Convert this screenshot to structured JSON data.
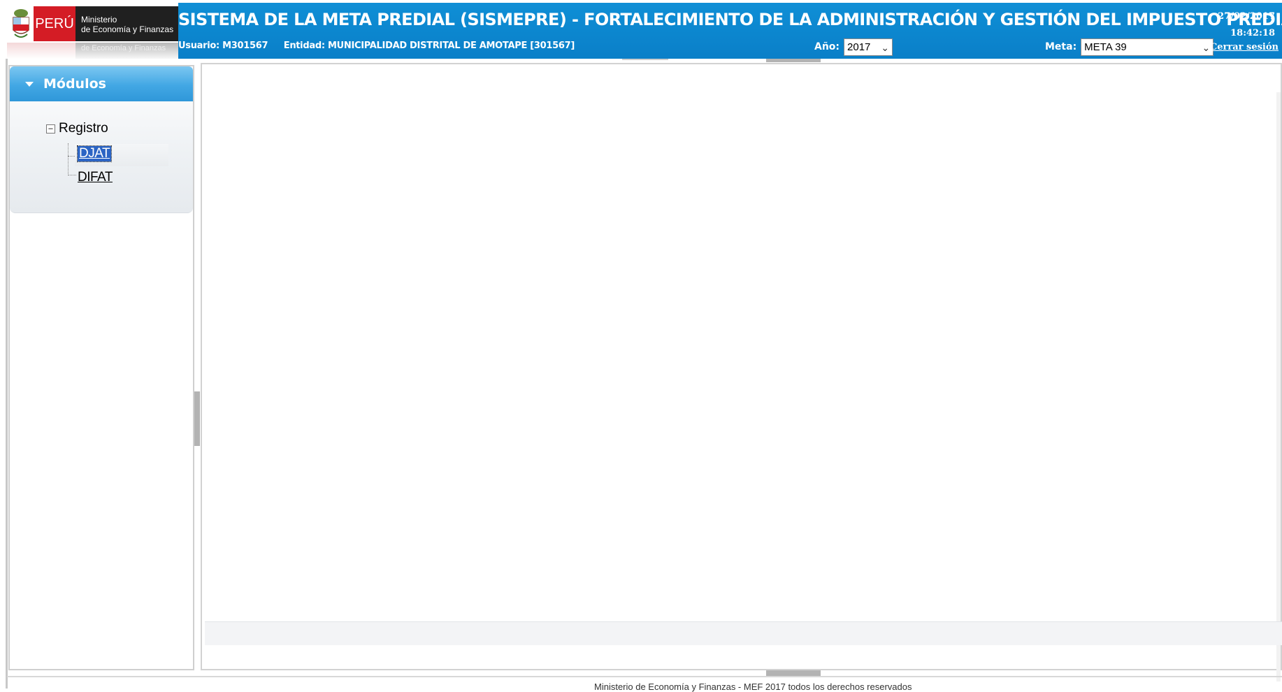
{
  "header": {
    "logo": {
      "country": "PERÚ",
      "ministry_line1": "Ministerio",
      "ministry_line2": "de Economía y Finanzas",
      "reflection": "de Economía y Finanzas"
    },
    "title": "SISTEMA DE LA META PREDIAL (SISMEPRE) - FORTALECIMIENTO DE LA ADMINISTRACIÓN Y GESTIÓN DEL IMPUESTO PREDIAL",
    "date": "27/02/2017",
    "time": "18:42:18",
    "user_label": "Usuario:",
    "user_value": "M301567",
    "entity_label": "Entidad:",
    "entity_value": "MUNICIPALIDAD DISTRITAL DE AMOTAPE [301567]",
    "year_label": "Año:",
    "year_value": "2017",
    "meta_label": "Meta:",
    "meta_value": "META 39",
    "logout": "Cerrar sesión"
  },
  "sidebar": {
    "panel_title": "Módulos",
    "tree": {
      "root": "Registro",
      "items": [
        {
          "label": "DJAT",
          "selected": true
        },
        {
          "label": "DIFAT",
          "selected": false
        }
      ]
    }
  },
  "footer": {
    "text": "Ministerio de Economía y Finanzas - MEF 2017 todos los derechos reservados"
  },
  "colors": {
    "header_blue": "#0a7fc8",
    "selected_bg": "#2b64c4",
    "peru_red": "#d41c25"
  }
}
